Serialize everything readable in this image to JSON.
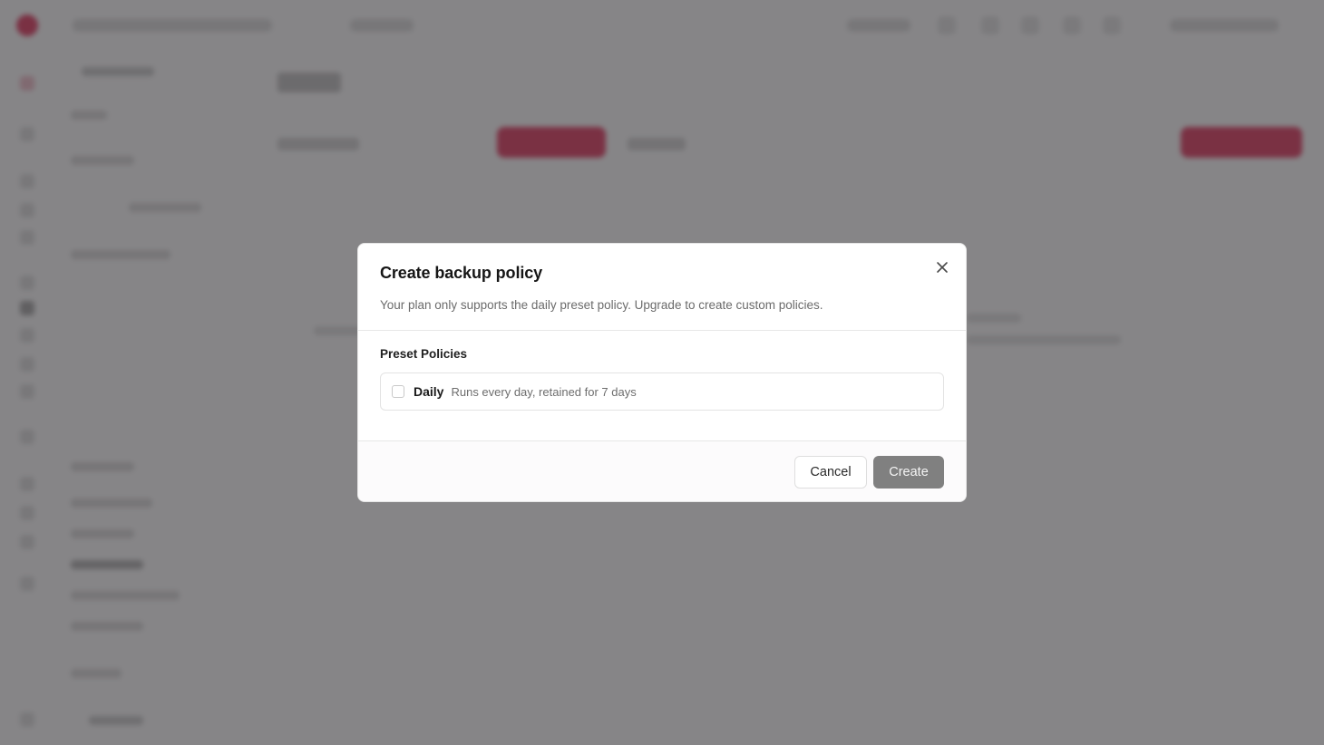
{
  "modal": {
    "title": "Create backup policy",
    "description": "Your plan only supports the daily preset policy. Upgrade to create custom policies.",
    "section_label": "Preset Policies",
    "policies": [
      {
        "name": "Daily",
        "description": "Runs every day, retained for 7 days",
        "checked": false
      }
    ],
    "cancel_label": "Cancel",
    "create_label": "Create",
    "close_icon": "close-icon"
  },
  "colors": {
    "overlay": "#3c3a3e",
    "brand_accent": "#e0234e",
    "create_button_disabled": "#808080"
  }
}
